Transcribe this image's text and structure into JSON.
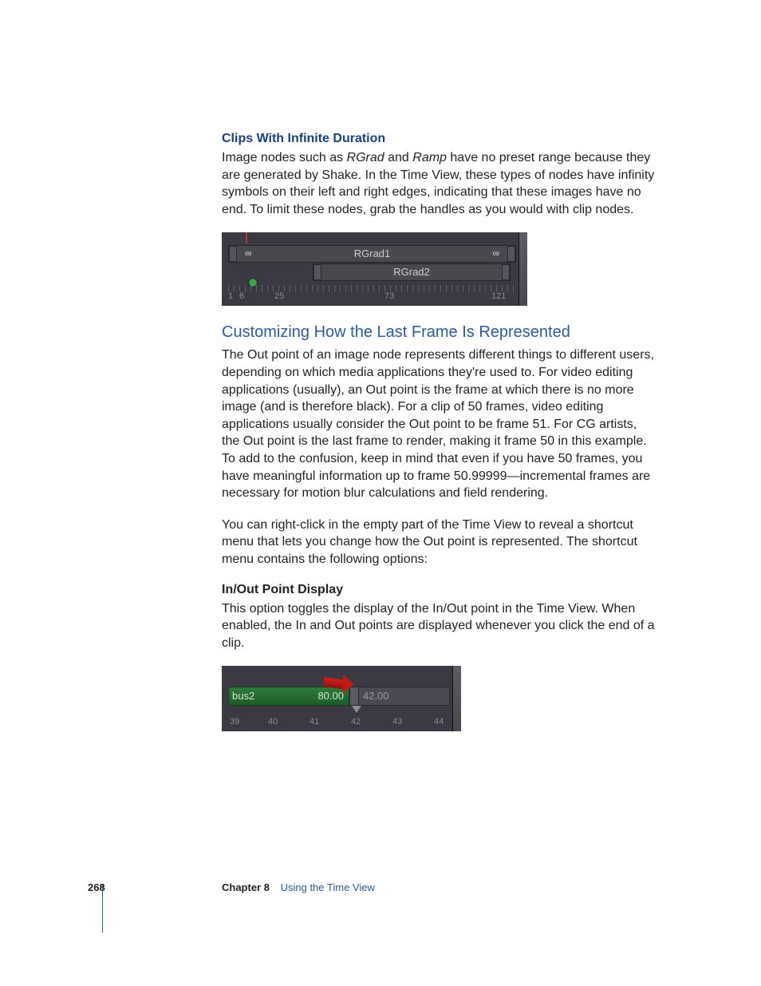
{
  "headings": {
    "clipsInfinite": "Clips With Infinite Duration",
    "customizing": "Customizing How the Last Frame Is Represented",
    "inOut": "In/Out Point Display"
  },
  "paragraphs": {
    "p1a": "Image nodes such as ",
    "p1_em1": "RGrad",
    "p1b": " and ",
    "p1_em2": "Ramp",
    "p1c": " have no preset range because they are generated by Shake. In the Time View, these types of nodes have infinity symbols on their left and right edges, indicating that these images have no end. To limit these nodes, grab the handles as you would with clip nodes.",
    "p2": "The Out point of an image node represents different things to different users, depending on which media applications they're used to. For video editing applications (usually), an Out point is the frame at which there is no more image (and is therefore black). For a clip of 50 frames, video editing applications usually consider the Out point to be frame 51. For CG artists, the Out point is the last frame to render, making it frame 50 in this example. To add to the confusion, keep in mind that even if you have 50 frames, you have meaningful information up to frame 50.99999—incremental frames are necessary for motion blur calculations and field rendering.",
    "p3": "You can right-click in the empty part of the Time View to reveal a shortcut menu that lets you change how the Out point is represented. The shortcut menu contains the following options:",
    "p4": "This option toggles the display of the In/Out point in the Time View. When enabled, the In and Out points are displayed whenever you click the end of a clip."
  },
  "figure1": {
    "track1Label": "RGrad1",
    "track2Label": "RGrad2",
    "infinityLeft": "∞",
    "infinityRight": "∞",
    "rulerNumbers": [
      "1",
      "6",
      "25",
      "73",
      "121"
    ]
  },
  "figure2": {
    "clipName": "bus2",
    "clipEndValue": "80.00",
    "grayValue": "42.00",
    "rulerNumbers": [
      "39",
      "40",
      "41",
      "42",
      "43",
      "44"
    ]
  },
  "footer": {
    "pageNumber": "268",
    "chapterLabel": "Chapter 8",
    "chapterTitle": "Using the Time View"
  }
}
